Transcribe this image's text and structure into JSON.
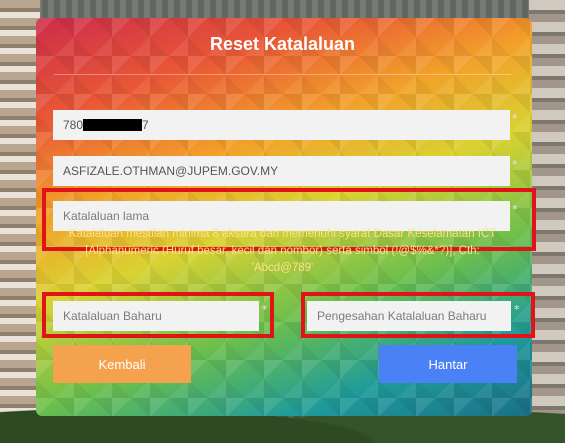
{
  "form": {
    "title": "Reset Katalaluan",
    "id_prefix": "780",
    "id_suffix": "7",
    "email": "ASFIZALE.OTHMAN@JUPEM.GOV.MY",
    "old_password_placeholder": "Katalaluan lama",
    "password_note": "Katalaluan mestilah minima 8 aksara dan memenuhi syarat Dasar Keselamatan ICT [Alphanumeric (Huruf besar, kecil dan nombor) serta simbol (!@$%&*?)], Cth: 'Abcd@789'",
    "new_password_placeholder": "Katalaluan Baharu",
    "confirm_password_placeholder": "Pengesahan Katalaluan Baharu",
    "required_mark": "*",
    "back_label": "Kembali",
    "submit_label": "Hantar"
  },
  "colors": {
    "highlight": "#e11218",
    "back_button": "#f4a24d",
    "submit_button": "#4a82f5",
    "note_text": "#ffe08a"
  }
}
